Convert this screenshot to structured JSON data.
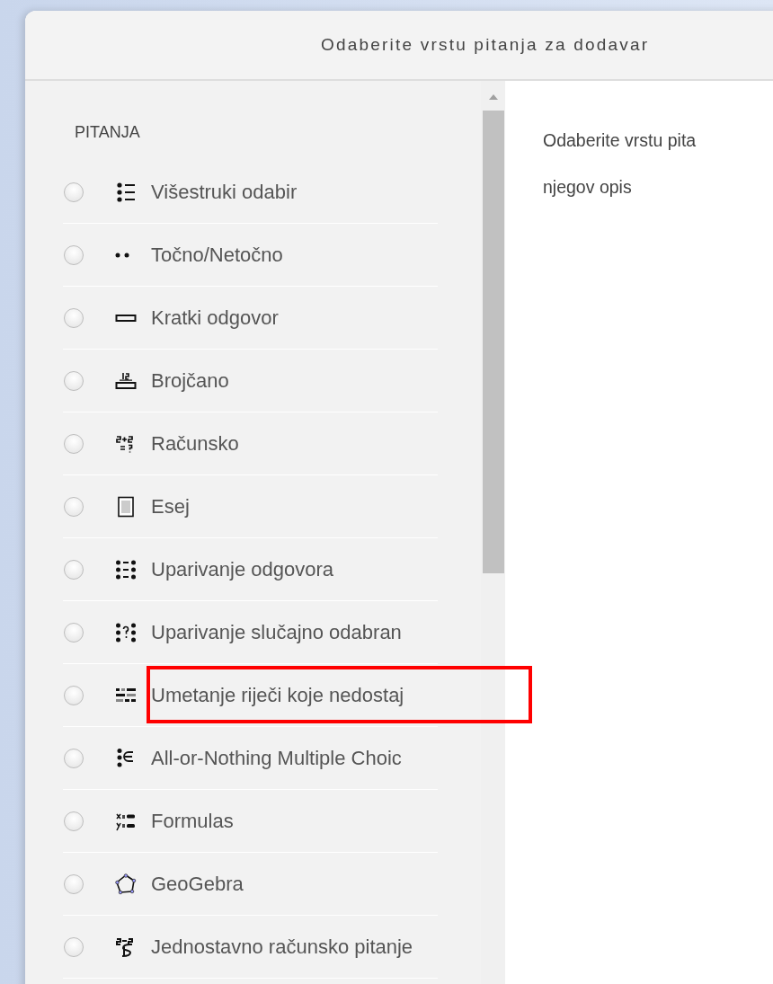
{
  "dialog": {
    "title": "Odaberite vrstu pitanja za dodavar"
  },
  "question_types": {
    "heading": "PITANJA",
    "items": [
      {
        "label": "Višestruki odabir",
        "selected": false,
        "highlighted": false
      },
      {
        "label": "Točno/Netočno",
        "selected": false,
        "highlighted": false
      },
      {
        "label": "Kratki odgovor",
        "selected": false,
        "highlighted": false
      },
      {
        "label": "Brojčano",
        "selected": false,
        "highlighted": false
      },
      {
        "label": "Računsko",
        "selected": false,
        "highlighted": false
      },
      {
        "label": "Esej",
        "selected": false,
        "highlighted": false
      },
      {
        "label": "Uparivanje odgovora",
        "selected": false,
        "highlighted": false
      },
      {
        "label": "Uparivanje slučajno odabran",
        "selected": false,
        "highlighted": false
      },
      {
        "label": "Umetanje riječi koje nedostaj",
        "selected": false,
        "highlighted": true
      },
      {
        "label": "All-or-Nothing Multiple Choic",
        "selected": false,
        "highlighted": false
      },
      {
        "label": "Formulas",
        "selected": false,
        "highlighted": false
      },
      {
        "label": "GeoGebra",
        "selected": false,
        "highlighted": false
      },
      {
        "label": "Jednostavno računsko pitanje",
        "selected": false,
        "highlighted": false
      }
    ]
  },
  "description": {
    "lines": [
      "Odaberite vrstu pita",
      "njegov opis"
    ]
  }
}
